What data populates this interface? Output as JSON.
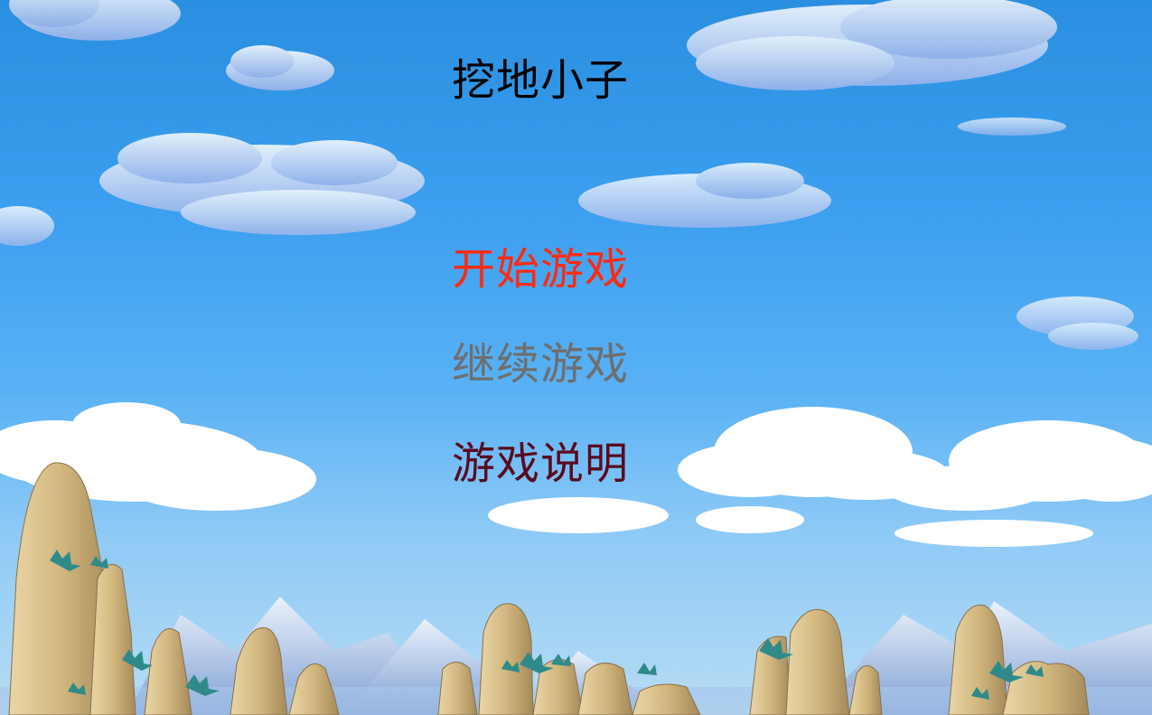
{
  "game": {
    "title": "挖地小子"
  },
  "menu": {
    "start": "开始游戏",
    "continue": "继续游戏",
    "help": "游戏说明"
  },
  "colors": {
    "title": "#000000",
    "start": "#ff2a10",
    "continue": "#6e6e6e",
    "help": "#5a0a1e",
    "sky_top": "#2a8fe0",
    "sky_bottom": "#b7dcf4",
    "rock": "#d8c08a",
    "plant": "#2f8a8a"
  },
  "icons": [
    "cloud-icon",
    "mountain-icon",
    "rock-pillar-icon",
    "plant-icon"
  ]
}
